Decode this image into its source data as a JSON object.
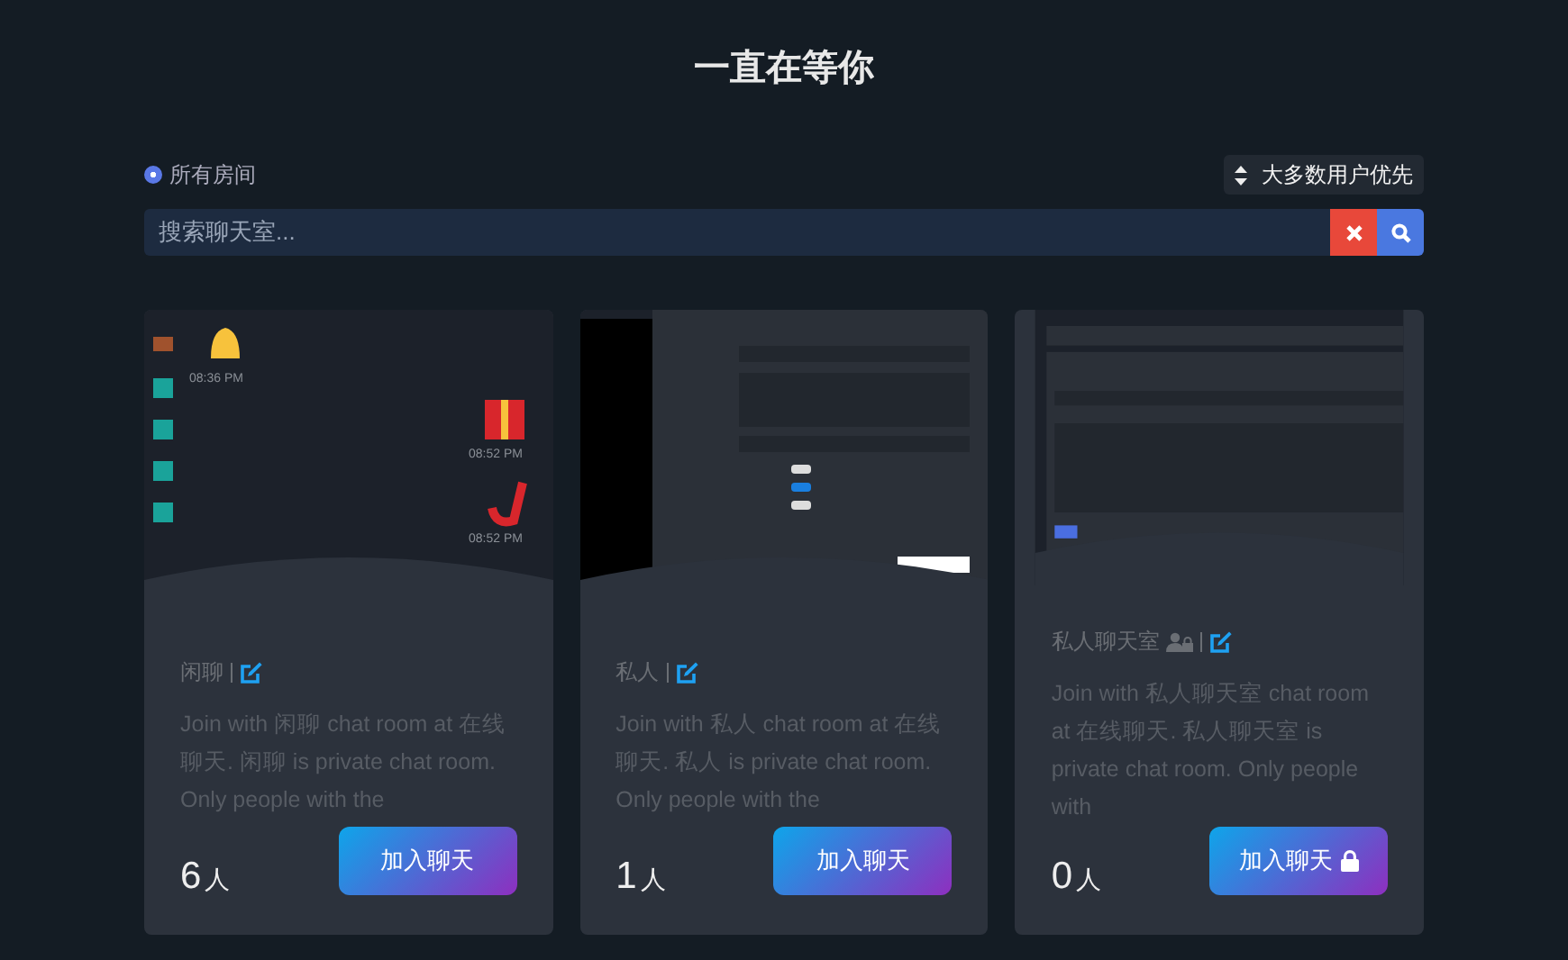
{
  "title": "一直在等你",
  "filter": {
    "label": "所有房间",
    "selected": true
  },
  "sort": {
    "label": "大多数用户优先"
  },
  "search": {
    "placeholder": "搜索聊天室..."
  },
  "rooms": [
    {
      "kind": "chat",
      "name": "闲聊",
      "private": false,
      "description": "Join with 闲聊 chat room at 在线聊天. 闲聊 is private chat room. Only people with the",
      "count": "6",
      "unit": "人",
      "button": "加入聊天",
      "locked": false,
      "times": [
        "08:36 PM",
        "08:52 PM",
        "08:52 PM"
      ]
    },
    {
      "kind": "form",
      "name": "私人",
      "private": false,
      "description": "Join with 私人 chat room at 在线聊天. 私人 is private chat room. Only people with the",
      "count": "1",
      "unit": "人",
      "button": "加入聊天",
      "locked": false
    },
    {
      "kind": "settings",
      "name": "私人聊天室",
      "private": true,
      "description": "Join with 私人聊天室 chat room at 在线聊天. 私人聊天室 is private chat room. Only people with",
      "count": "0",
      "unit": "人",
      "button": "加入聊天",
      "locked": true
    }
  ]
}
